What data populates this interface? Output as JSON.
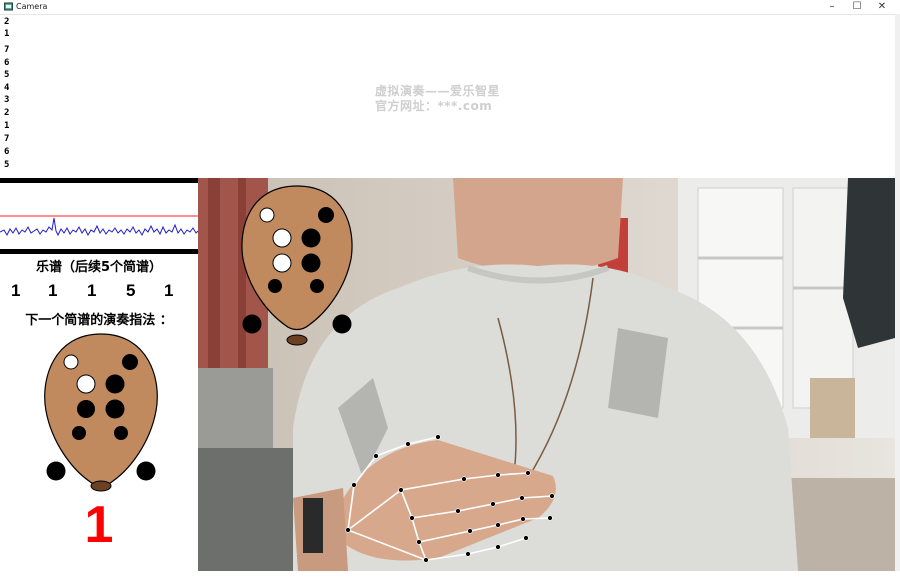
{
  "window": {
    "title": "Camera",
    "minimize_glyph": "–",
    "maximize_glyph": "☐",
    "close_glyph": "✕"
  },
  "scale_notes": [
    "2",
    "1",
    "7",
    "6",
    "5",
    "4",
    "3",
    "2",
    "1",
    "7",
    "6",
    "5"
  ],
  "watermark": {
    "line1": "虚拟演奏——爱乐智星",
    "line2": "官方网址：***.com"
  },
  "left_panel": {
    "score_title": "乐谱（后续5个简谱）",
    "upcoming_notes": [
      "1",
      "1",
      "1",
      "5",
      "1"
    ],
    "fingering_title": "下一个简谱的演奏指法 ：",
    "next_note": "1"
  },
  "colors": {
    "ocarina_body": "#c08a5e",
    "waveform": "#1f1fcc",
    "threshold_line": "#ff2020",
    "next_note": "#ff0000",
    "hand_skeleton": "#ffffff"
  },
  "icons": {
    "app": "camera-app-icon",
    "ocarina": "ocarina-fingering-icon"
  }
}
